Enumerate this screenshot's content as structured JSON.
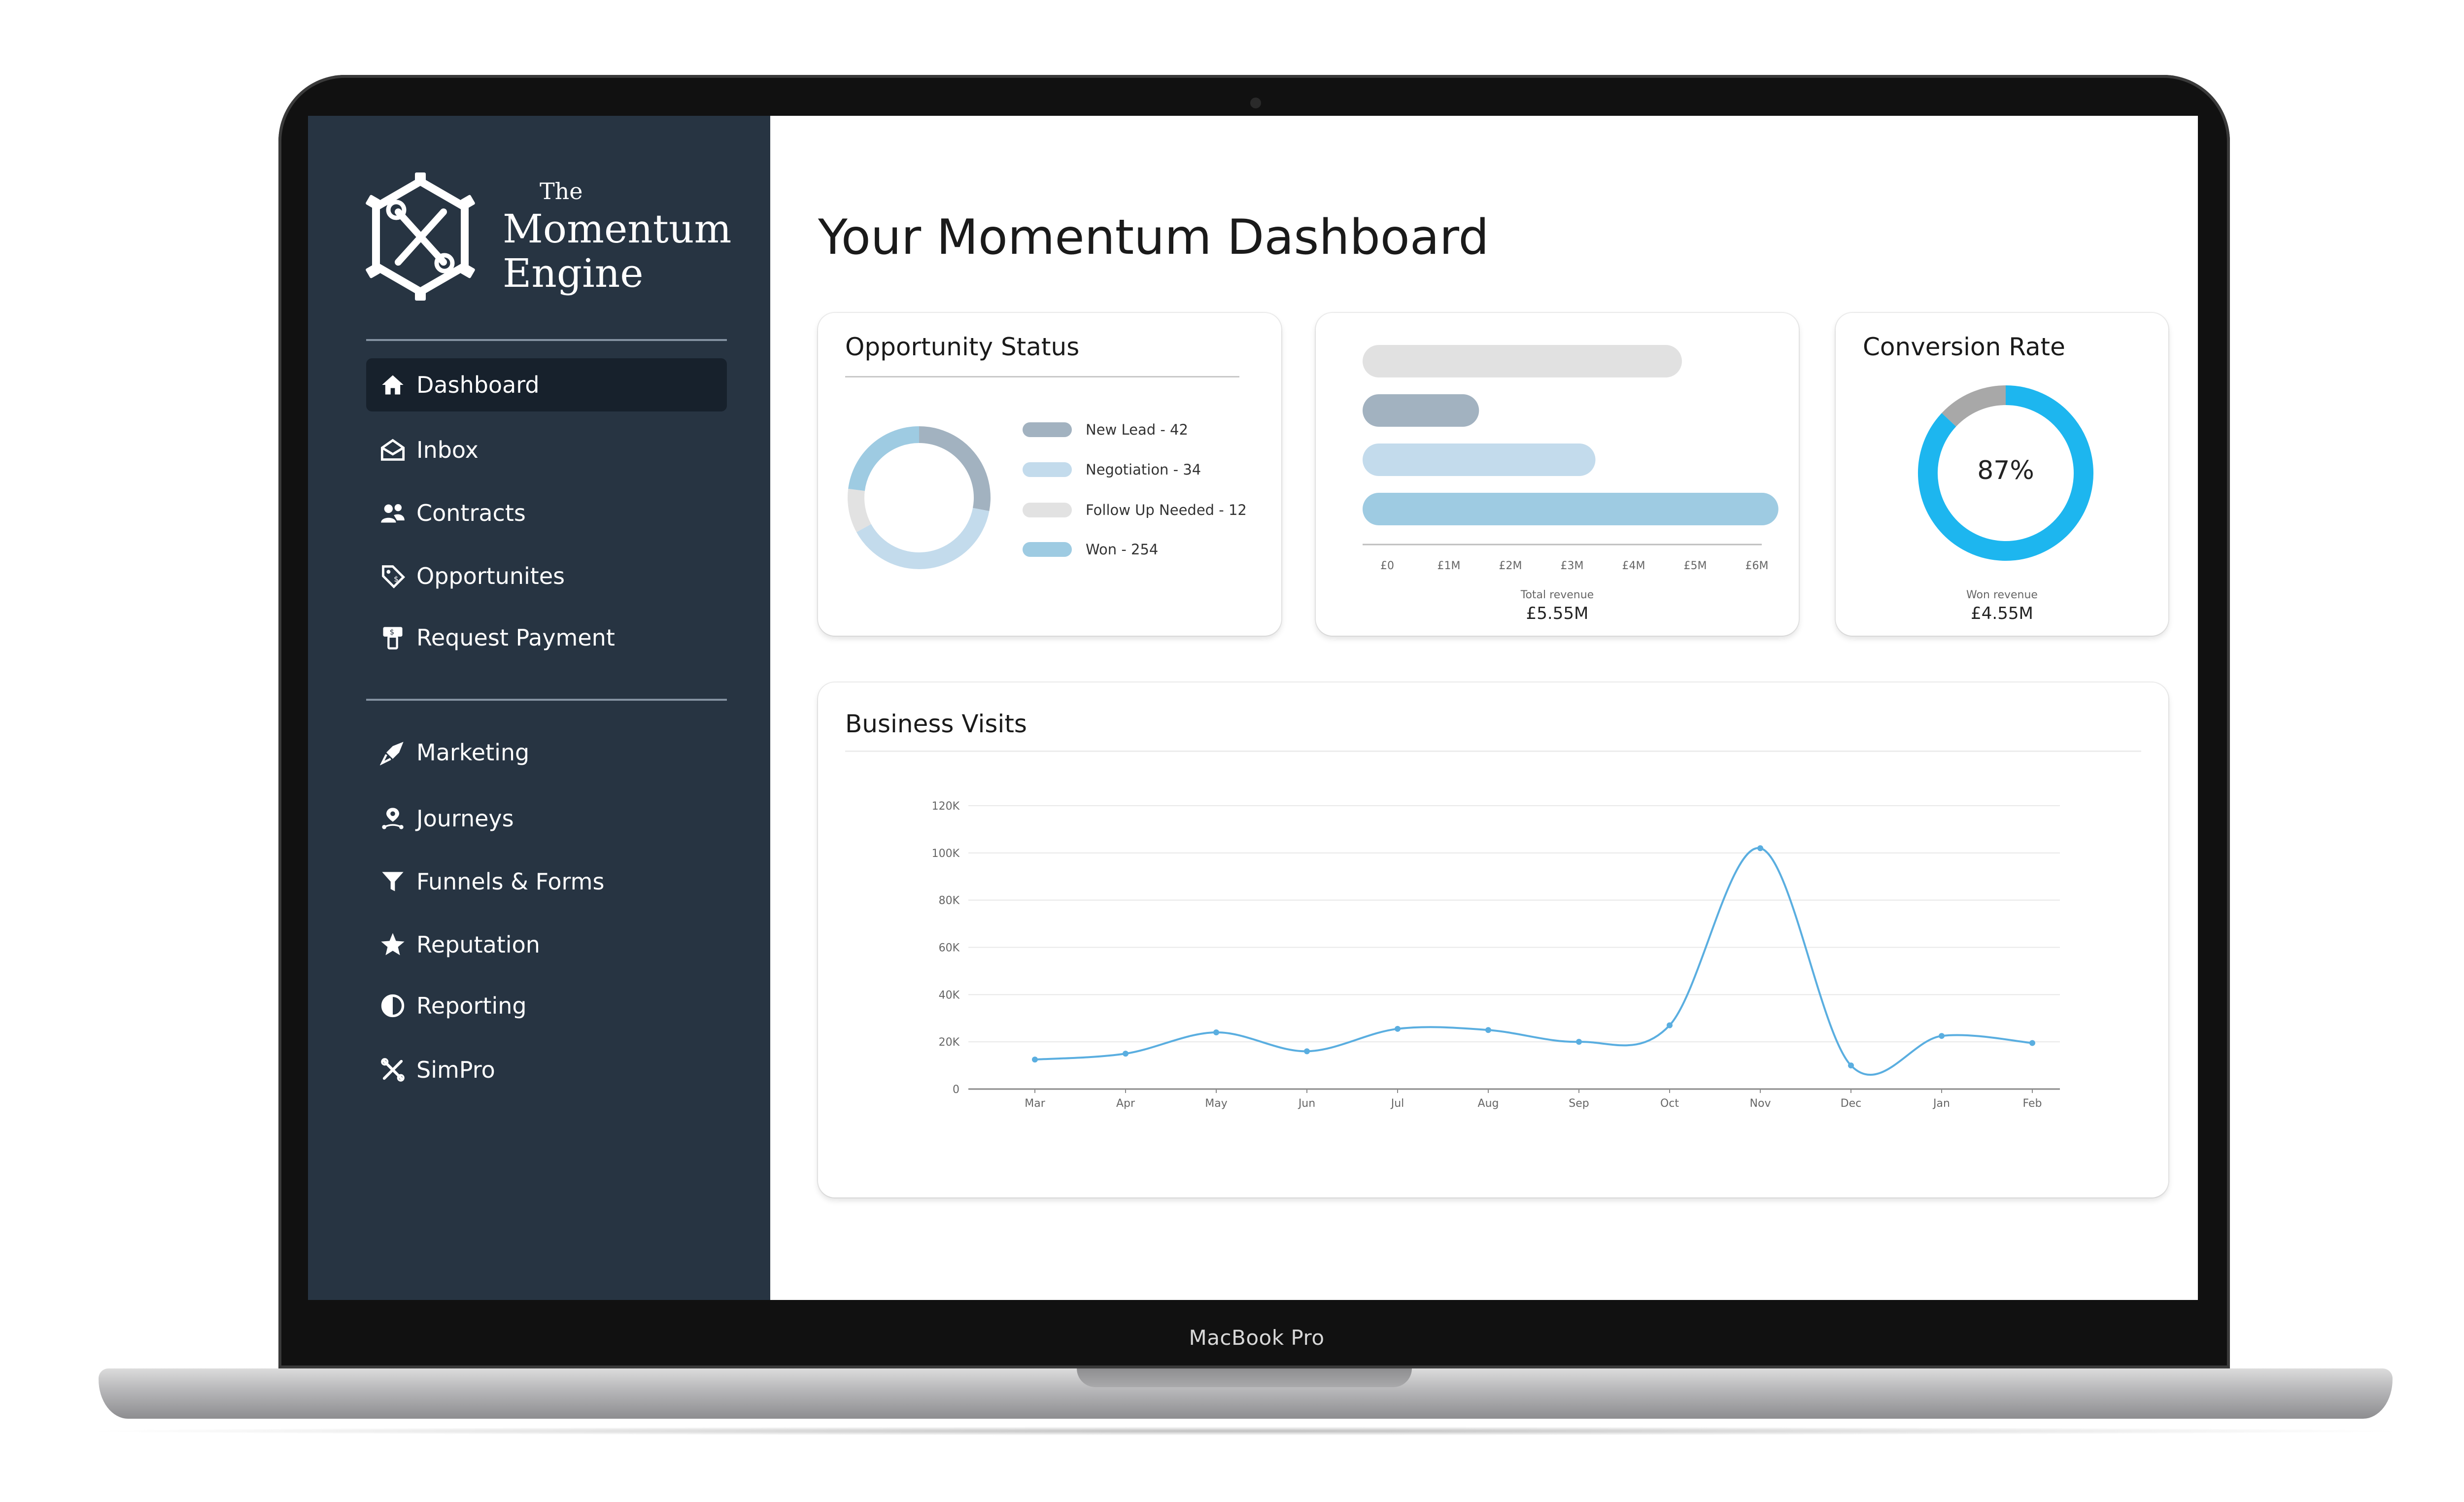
{
  "device": {
    "label": "MacBook Pro"
  },
  "brand": {
    "the": "The",
    "line1": "Momentum",
    "line2": "Engine"
  },
  "nav": {
    "primary": [
      {
        "label": "Dashboard",
        "icon": "home-icon",
        "active": true
      },
      {
        "label": "Inbox",
        "icon": "envelope-open-icon"
      },
      {
        "label": "Contracts",
        "icon": "users-icon"
      },
      {
        "label": "Opportunites",
        "icon": "price-tag-icon"
      },
      {
        "label": "Request Payment",
        "icon": "payment-icon"
      }
    ],
    "secondary": [
      {
        "label": "Marketing",
        "icon": "rocket-icon"
      },
      {
        "label": "Journeys",
        "icon": "route-icon"
      },
      {
        "label": "Funnels & Forms",
        "icon": "funnel-icon"
      },
      {
        "label": "Reputation",
        "icon": "star-icon"
      },
      {
        "label": "Reporting",
        "icon": "pie-chart-icon"
      },
      {
        "label": "SimPro",
        "icon": "tools-icon"
      }
    ]
  },
  "main": {
    "title": "Your Momentum Dashboard"
  },
  "opportunity": {
    "title": "Opportunity Status",
    "legend": [
      {
        "label": "New Lead - 42",
        "color": "#a2b2c0"
      },
      {
        "label": "Negotiation - 34",
        "color": "#c3dbec"
      },
      {
        "label": "Follow Up Needed - 12",
        "color": "#e2e2e2"
      },
      {
        "label": "Won - 254",
        "color": "#9ecbe2"
      }
    ]
  },
  "revenue": {
    "caption": "Total revenue",
    "value": "£5.55M"
  },
  "conversion": {
    "title": "Conversion Rate",
    "percent_label": "87%",
    "caption": "Won revenue",
    "value": "£4.55M"
  },
  "visits": {
    "title": "Business Visits"
  },
  "colors": {
    "sidebar": "#273442",
    "accent": "#1db6ef",
    "line": "#5aaee0"
  },
  "chart_data": [
    {
      "type": "pie",
      "variant": "donut",
      "title": "Opportunity Status",
      "categories": [
        "New Lead",
        "Negotiation",
        "Follow Up Needed",
        "Won"
      ],
      "values": [
        42,
        34,
        12,
        254
      ],
      "colors": [
        "#a2b2c0",
        "#c3dbec",
        "#e2e2e2",
        "#9ecbe2"
      ],
      "shown_proportions": [
        0.28,
        0.39,
        0.1,
        0.23
      ],
      "legend": "right"
    },
    {
      "type": "bar",
      "orientation": "horizontal",
      "values": [
        4.8,
        1.75,
        3.5,
        6.25
      ],
      "colors": [
        "#e1e1e1",
        "#a2b2c0",
        "#c3dbec",
        "#9ecbe2"
      ],
      "ticks": [
        "£0",
        "£1M",
        "£2M",
        "£3M",
        "£4M",
        "£5M",
        "£6M"
      ],
      "xlim": [
        0,
        6
      ],
      "xlabel": "Total revenue",
      "total_label": "£5.55M"
    },
    {
      "type": "pie",
      "variant": "donut",
      "title": "Conversion Rate",
      "values": [
        87,
        13
      ],
      "colors": [
        "#1db6ef",
        "#a8a8a8"
      ],
      "center_label": "87%",
      "caption": "Won revenue",
      "caption_value": "£4.55M"
    },
    {
      "type": "line",
      "title": "Business Visits",
      "categories": [
        "Mar",
        "Apr",
        "May",
        "Jun",
        "Jul",
        "Aug",
        "Sep",
        "Oct",
        "Nov",
        "Dec",
        "Jan",
        "Feb"
      ],
      "series": [
        {
          "values": [
            12500,
            15000,
            24000,
            16000,
            25500,
            25000,
            20000,
            27000,
            102000,
            10000,
            22500,
            19500
          ]
        }
      ],
      "yticks": [
        "0",
        "20K",
        "40K",
        "60K",
        "80K",
        "100K",
        "120K"
      ],
      "ylim": [
        0,
        120000
      ],
      "grid": true,
      "color": "#5aaee0"
    }
  ]
}
